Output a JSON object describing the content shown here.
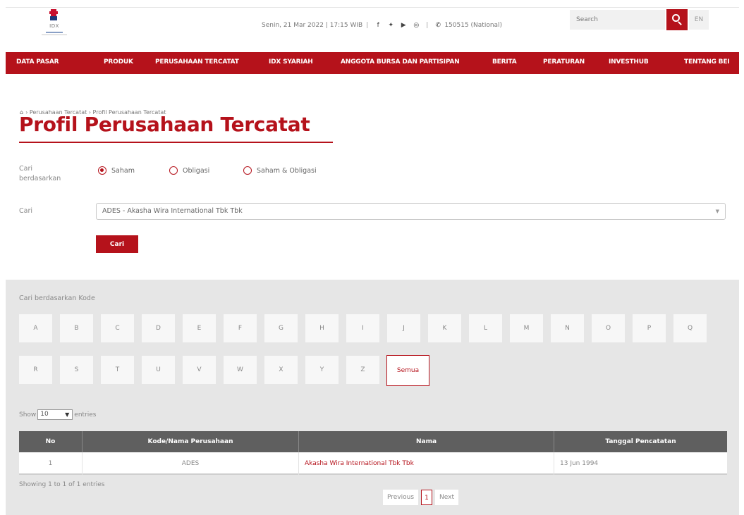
{
  "header": {
    "logo_text": "IDX",
    "date_time": "Senin, 21 Mar 2022 | 17:15 WIB",
    "call_center": "150515 (National)",
    "search_placeholder": "Search",
    "lang": "EN",
    "icons": [
      "facebook-icon",
      "twitter-icon",
      "youtube-icon",
      "instagram-icon",
      "phone-icon"
    ]
  },
  "nav": {
    "items": [
      "DATA PASAR",
      "PRODUK",
      "PERUSAHAAN TERCATAT",
      "IDX SYARIAH",
      "ANGGOTA BURSA DAN PARTISIPAN",
      "BERITA",
      "PERATURAN",
      "INVESTHUB",
      "TENTANG BEI"
    ]
  },
  "breadcrumb": {
    "items": [
      "Perusahaan Tercatat",
      "Profil Perusahaan Tercatat"
    ]
  },
  "page": {
    "title": "Profil Perusahaan Tercatat"
  },
  "form": {
    "cari_berdasarkan_label": "Cari berdasarkan",
    "radio_options": [
      "Saham",
      "Obligasi",
      "Saham & Obligasi"
    ],
    "selected_radio": "Saham",
    "cari_label": "Cari",
    "select_value": "ADES - Akasha Wira International Tbk Tbk",
    "submit_label": "Cari"
  },
  "kode_panel": {
    "label": "Cari berdasarkan Kode",
    "letters_row1": [
      "A",
      "B",
      "C",
      "D",
      "E",
      "F",
      "G",
      "H",
      "I",
      "J",
      "K",
      "L",
      "M",
      "N",
      "O",
      "P",
      "Q"
    ],
    "letters_row2": [
      "R",
      "S",
      "T",
      "U",
      "V",
      "W",
      "X",
      "Y",
      "Z",
      "Semua"
    ]
  },
  "table": {
    "show_label": "Show",
    "entries_value": "10",
    "entries_label": "entries",
    "columns": [
      "No",
      "Kode/Nama Perusahaan",
      "Nama",
      "Tanggal Pencatatan"
    ],
    "rows": [
      {
        "no": "1",
        "kode": "ADES",
        "nama": "Akasha Wira International Tbk Tbk",
        "tanggal": "13 Jun 1994"
      }
    ],
    "showing_text": "Showing 1 to 1 of 1 entries",
    "pager": {
      "previous": "Previous",
      "current": "1",
      "next": "Next"
    }
  },
  "colors": {
    "accent": "#b5121b",
    "table_header": "#5f5f5f",
    "panel_bg": "#e6e6e6"
  }
}
